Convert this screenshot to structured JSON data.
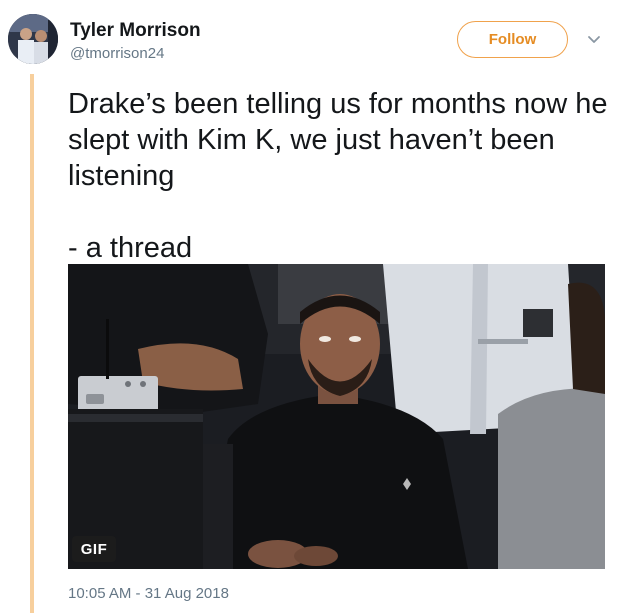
{
  "user": {
    "name": "Tyler Morrison",
    "handle": "@tmorrison24",
    "avatar_icon": "user-avatar"
  },
  "follow_button": {
    "label": "Follow",
    "color": "#e58c23"
  },
  "menu_icon": "chevron-down-icon",
  "tweet": {
    "text": "Drake’s been telling us for months now he slept with Kim K, we just haven’t been listening",
    "thread_note": "- a thread"
  },
  "media": {
    "type": "gif",
    "badge": "GIF"
  },
  "timestamp": "10:05 AM - 31 Aug 2018",
  "colors": {
    "thread_line": "#f7cf9d",
    "name": "#14171a",
    "secondary": "#657786"
  }
}
